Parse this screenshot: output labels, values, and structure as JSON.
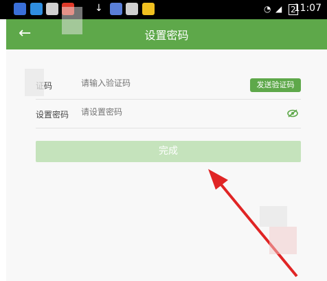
{
  "status": {
    "time": "11:07",
    "battery_label": "2"
  },
  "header": {
    "title": "设置密码",
    "back_icon": "arrow-left-icon"
  },
  "form": {
    "code_label": "证码",
    "code_placeholder": "请输入验证码",
    "send_code_label": "发送验证码",
    "password_label": "设置密码",
    "password_placeholder": "请设置密码",
    "eye_icon": "eye-toggle-icon"
  },
  "actions": {
    "done_label": "完成"
  },
  "colors": {
    "accent": "#5ea84a",
    "disabled_button": "#c5e3bc",
    "arrow": "#e02525"
  }
}
